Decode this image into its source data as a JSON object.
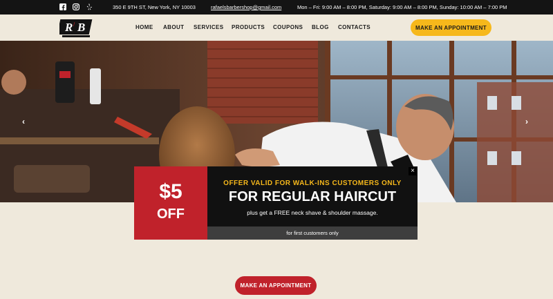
{
  "topbar": {
    "socials": [
      {
        "icon": "facebook-icon"
      },
      {
        "icon": "instagram-icon"
      },
      {
        "icon": "yelp-icon"
      }
    ],
    "address": "350 E 9TH ST, New York, NY 10003",
    "email": "rafaelsbarbershop@gmail.com",
    "hours": "Mon – Fri: 9:00 AM – 8:00 PM, Saturday: 9:00 AM – 8:00 PM, Sunday: 10:00 AM – 7:00 PM"
  },
  "header": {
    "logo_text": "RB",
    "nav": [
      "HOME",
      "ABOUT",
      "SERVICES",
      "PRODUCTS",
      "COUPONS",
      "BLOG",
      "CONTACTS"
    ],
    "cta": "MAKE AN APPOINTMENT"
  },
  "hero": {
    "prev_icon": "chevron-left-icon",
    "next_icon": "chevron-right-icon"
  },
  "promo": {
    "price": "$5",
    "off": "OFF",
    "valid": "OFFER VALID FOR WALK-INS CUSTOMERS ONLY",
    "headline": "FOR REGULAR HAIRCUT",
    "extra": "plus get a FREE neck shave & shoulder massage.",
    "footnote": "for first customers only",
    "close": "×"
  },
  "bottom_cta": "MAKE AN APPOINTMENT",
  "colors": {
    "accent_yellow": "#f6b81b",
    "accent_red": "#c0222b",
    "background": "#efe9dc",
    "topbar": "#141414"
  }
}
